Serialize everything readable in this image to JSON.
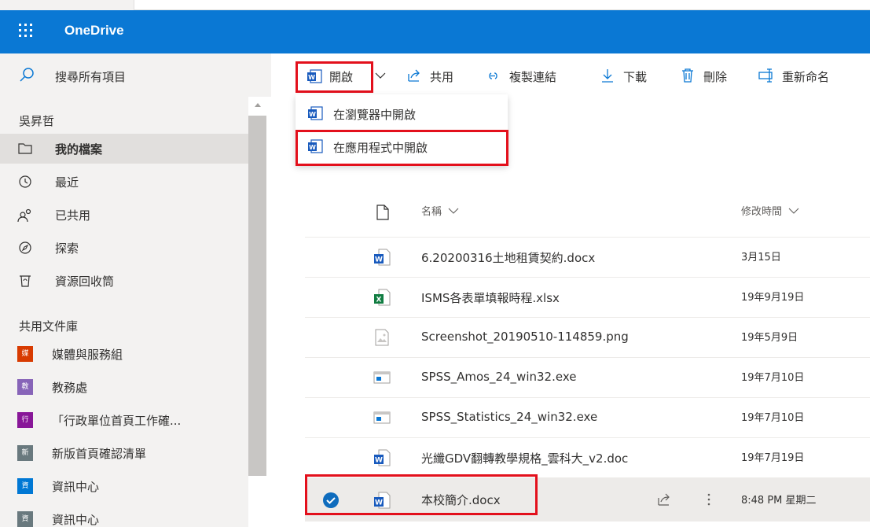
{
  "app": {
    "title": "OneDrive"
  },
  "search": {
    "placeholder": "搜尋所有項目"
  },
  "sidebar": {
    "user_name": "吳昇哲",
    "items": [
      {
        "label": "我的檔案",
        "icon": "folder-icon",
        "selected": true
      },
      {
        "label": "最近",
        "icon": "recent-icon"
      },
      {
        "label": "已共用",
        "icon": "shared-icon"
      },
      {
        "label": "探索",
        "icon": "discover-icon"
      },
      {
        "label": "資源回收筒",
        "icon": "recycle-bin-icon"
      }
    ],
    "libraries_heading": "共用文件庫",
    "libraries": [
      {
        "label": "媒體與服務組",
        "tile": "媒",
        "color": "#d83b01"
      },
      {
        "label": "教務處",
        "tile": "教",
        "color": "#8764b8"
      },
      {
        "label": "「行政單位首頁工作確...",
        "tile": "行",
        "color": "#881798"
      },
      {
        "label": "新版首頁確認清單",
        "tile": "新",
        "color": "#69797e"
      },
      {
        "label": "資訊中心",
        "tile": "資",
        "color": "#0078d4"
      },
      {
        "label": "資訊中心",
        "tile": "資",
        "color": "#69797e"
      }
    ]
  },
  "toolbar": {
    "open": "開啟",
    "share": "共用",
    "copy_link": "複製連結",
    "download": "下載",
    "delete": "刪除",
    "rename": "重新命名"
  },
  "open_menu": {
    "open_in_browser": "在瀏覽器中開啟",
    "open_in_app": "在應用程式中開啟"
  },
  "file_list": {
    "col_name": "名稱",
    "col_modified": "修改時間",
    "files": [
      {
        "name": "6.20200316土地租賃契約.docx",
        "modified": "3月15日",
        "type": "word"
      },
      {
        "name": "ISMS各表單填報時程.xlsx",
        "modified": "19年9月19日",
        "type": "excel"
      },
      {
        "name": "Screenshot_20190510-114859.png",
        "modified": "19年5月9日",
        "type": "image"
      },
      {
        "name": "SPSS_Amos_24_win32.exe",
        "modified": "19年7月10日",
        "type": "exe"
      },
      {
        "name": "SPSS_Statistics_24_win32.exe",
        "modified": "19年7月10日",
        "type": "exe"
      },
      {
        "name": "光纖GDV翻轉教學規格_雲科大_v2.doc",
        "modified": "19年7月19日",
        "type": "word"
      },
      {
        "name": "本校簡介.docx",
        "modified": "8:48 PM 星期二",
        "type": "word",
        "selected": true
      }
    ]
  },
  "colors": {
    "brand": "#0a78d4",
    "highlight": "#e3101c",
    "word": "#185abd",
    "excel": "#107c41",
    "selected_check": "#0f6cbd"
  }
}
